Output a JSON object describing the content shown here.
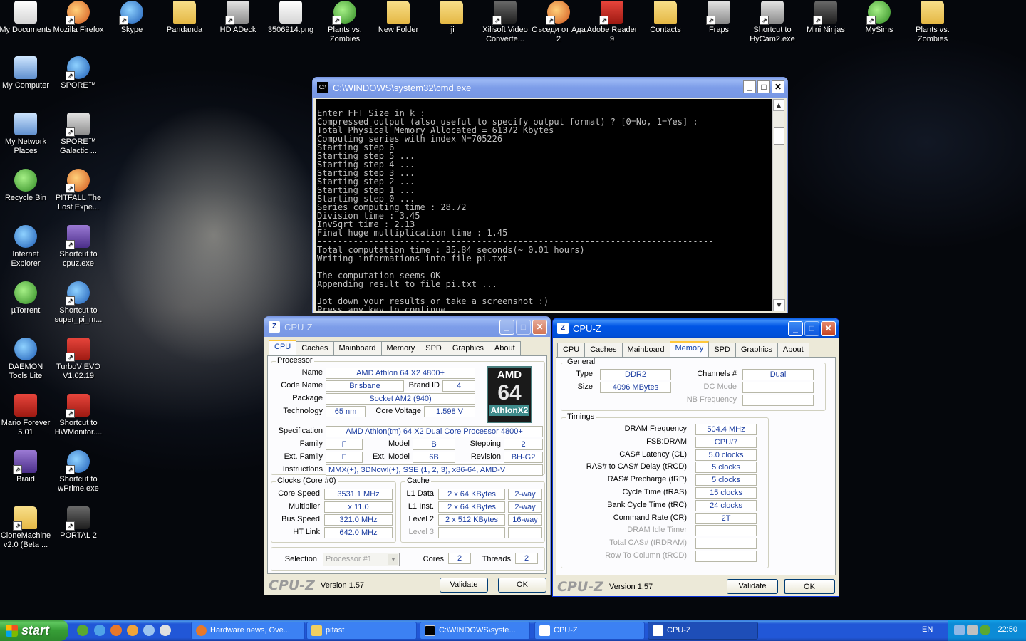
{
  "desktop": {
    "icons": [
      {
        "label": "My Documents",
        "icon": "documents-folder-icon"
      },
      {
        "label": "Mozilla Firefox",
        "icon": "firefox-icon"
      },
      {
        "label": "Skype",
        "icon": "skype-icon"
      },
      {
        "label": "Pandanda",
        "icon": "folder-icon"
      },
      {
        "label": "HD ADeck",
        "icon": "hd-adeck-icon"
      },
      {
        "label": "3506914.png",
        "icon": "png-file-icon"
      },
      {
        "label": "Plants vs. Zombies",
        "icon": "plants-vs-zombies-icon"
      },
      {
        "label": "New Folder",
        "icon": "folder-icon"
      },
      {
        "label": "iji",
        "icon": "folder-icon"
      },
      {
        "label": "Xilisoft Video Converte...",
        "icon": "xilisoft-icon"
      },
      {
        "label": "Съседи от Ада 2",
        "icon": "game-icon"
      },
      {
        "label": "Adobe Reader 9",
        "icon": "adobe-reader-icon"
      },
      {
        "label": "Contacts",
        "icon": "folder-icon"
      },
      {
        "label": "Fraps",
        "icon": "fraps-icon"
      },
      {
        "label": "Shortcut to HyCam2.exe",
        "icon": "hycam-icon"
      },
      {
        "label": "Mini Ninjas",
        "icon": "mini-ninjas-icon"
      },
      {
        "label": "MySims",
        "icon": "mysims-icon"
      },
      {
        "label": "Plants vs. Zombies",
        "icon": "folder-icon"
      },
      {
        "label": "My Computer",
        "icon": "my-computer-icon"
      },
      {
        "label": "SPORE™",
        "icon": "spore-icon"
      },
      {
        "label": "My Network Places",
        "icon": "network-places-icon"
      },
      {
        "label": "SPORE™ Galactic ...",
        "icon": "spore-galactic-icon"
      },
      {
        "label": "Recycle Bin",
        "icon": "recycle-bin-icon"
      },
      {
        "label": "PITFALL The Lost Expe...",
        "icon": "pitfall-icon"
      },
      {
        "label": "Internet Explorer",
        "icon": "internet-explorer-icon"
      },
      {
        "label": "Shortcut to cpuz.exe",
        "icon": "cpuz-icon"
      },
      {
        "label": "µTorrent",
        "icon": "utorrent-icon"
      },
      {
        "label": "Shortcut to super_pi_m...",
        "icon": "super-pi-icon"
      },
      {
        "label": "DAEMON Tools Lite",
        "icon": "daemon-tools-icon"
      },
      {
        "label": "TurboV EVO V1.02.19",
        "icon": "turbov-icon"
      },
      {
        "label": "Mario Forever 5.01",
        "icon": "mario-icon"
      },
      {
        "label": "Shortcut to HWMonitor....",
        "icon": "hwmonitor-icon"
      },
      {
        "label": "Braid",
        "icon": "braid-icon"
      },
      {
        "label": "Shortcut to wPrime.exe",
        "icon": "wprime-icon"
      },
      {
        "label": "CloneMachine v2.0 (Beta ...",
        "icon": "folder-icon"
      },
      {
        "label": "PORTAL 2",
        "icon": "portal2-icon"
      }
    ]
  },
  "cmd": {
    "title": "C:\\WINDOWS\\system32\\cmd.exe",
    "lines": [
      "Enter FFT Size in k :",
      "Compressed output (also useful to specify output format) ? [0=No, 1=Yes] :",
      "Total Physical Memory Allocated = 61372 Kbytes",
      "Computing series with index N=705226",
      "Starting step 6",
      "Starting step 5 ...",
      "Starting step 4 ...",
      "Starting step 3 ...",
      "Starting step 2 ...",
      "Starting step 1 ...",
      "Starting step 0 ...",
      "Series computing time : 28.72",
      "Division time : 3.45",
      "InvSqrt time : 2.13",
      "Final huge multiplication time : 1.45",
      "-----------------------------------------------------------------------------",
      "Total computation time : 35.84 seconds(~ 0.01 hours)",
      "Writing informations into file pi.txt",
      "",
      "The computation seems OK",
      "Appending result to file pi.txt ...",
      "",
      "Jot down your results or take a screenshot :)",
      "Press any key to continue . . ."
    ]
  },
  "cpuz1": {
    "title": "CPU-Z",
    "tabs": [
      "CPU",
      "Caches",
      "Mainboard",
      "Memory",
      "SPD",
      "Graphics",
      "About"
    ],
    "processor": {
      "group": "Processor",
      "name_label": "Name",
      "name": "AMD Athlon 64 X2 4800+",
      "codename_label": "Code Name",
      "codename": "Brisbane",
      "brandid_label": "Brand ID",
      "brandid": "4",
      "package_label": "Package",
      "package": "Socket AM2 (940)",
      "tech_label": "Technology",
      "tech": "65 nm",
      "voltage_label": "Core Voltage",
      "voltage": "1.598 V",
      "spec_label": "Specification",
      "spec": "AMD Athlon(tm) 64 X2 Dual Core Processor 4800+",
      "family_label": "Family",
      "family": "F",
      "model_label": "Model",
      "model": "B",
      "stepping_label": "Stepping",
      "stepping": "2",
      "extfamily_label": "Ext. Family",
      "extfamily": "F",
      "extmodel_label": "Ext. Model",
      "extmodel": "6B",
      "revision_label": "Revision",
      "revision": "BH-G2",
      "instr_label": "Instructions",
      "instr": "MMX(+), 3DNow!(+), SSE (1, 2, 3), x86-64, AMD-V",
      "logo_brand": "AMD",
      "logo_num": "64",
      "logo_line": "AthlonX2"
    },
    "clocks": {
      "group": "Clocks (Core #0)",
      "corespeed_label": "Core Speed",
      "corespeed": "3531.1 MHz",
      "mult_label": "Multiplier",
      "mult": "x 11.0",
      "bus_label": "Bus Speed",
      "bus": "321.0 MHz",
      "ht_label": "HT Link",
      "ht": "642.0 MHz"
    },
    "cache": {
      "group": "Cache",
      "l1d_label": "L1 Data",
      "l1d": "2 x 64 KBytes",
      "l1d_way": "2-way",
      "l1i_label": "L1 Inst.",
      "l1i": "2 x 64 KBytes",
      "l1i_way": "2-way",
      "l2_label": "Level 2",
      "l2": "2 x 512 KBytes",
      "l2_way": "16-way",
      "l3_label": "Level 3"
    },
    "selection_label": "Selection",
    "selection": "Processor #1",
    "cores_label": "Cores",
    "cores": "2",
    "threads_label": "Threads",
    "threads": "2",
    "logo": "CPU-Z",
    "version": "Version 1.57",
    "validate": "Validate",
    "ok": "OK"
  },
  "cpuz2": {
    "title": "CPU-Z",
    "tabs": [
      "CPU",
      "Caches",
      "Mainboard",
      "Memory",
      "SPD",
      "Graphics",
      "About"
    ],
    "general": {
      "group": "General",
      "type_label": "Type",
      "type": "DDR2",
      "size_label": "Size",
      "size": "4096 MBytes",
      "channels_label": "Channels #",
      "channels": "Dual",
      "dcmode_label": "DC Mode",
      "nbfreq_label": "NB Frequency"
    },
    "timings": {
      "group": "Timings",
      "rows": [
        {
          "label": "DRAM Frequency",
          "value": "504.4 MHz",
          "dim": false
        },
        {
          "label": "FSB:DRAM",
          "value": "CPU/7",
          "dim": false
        },
        {
          "label": "CAS# Latency (CL)",
          "value": "5.0 clocks",
          "dim": false
        },
        {
          "label": "RAS# to CAS# Delay (tRCD)",
          "value": "5 clocks",
          "dim": false
        },
        {
          "label": "RAS# Precharge (tRP)",
          "value": "5 clocks",
          "dim": false
        },
        {
          "label": "Cycle Time (tRAS)",
          "value": "15 clocks",
          "dim": false
        },
        {
          "label": "Bank Cycle Time (tRC)",
          "value": "24 clocks",
          "dim": false
        },
        {
          "label": "Command Rate (CR)",
          "value": "2T",
          "dim": false
        },
        {
          "label": "DRAM Idle Timer",
          "value": "",
          "dim": true
        },
        {
          "label": "Total CAS# (tRDRAM)",
          "value": "",
          "dim": true
        },
        {
          "label": "Row To Column (tRCD)",
          "value": "",
          "dim": true
        }
      ]
    },
    "logo": "CPU-Z",
    "version": "Version 1.57",
    "validate": "Validate",
    "ok": "OK"
  },
  "taskbar": {
    "start": "start",
    "tasks": [
      {
        "label": "Hardware news, Ove..."
      },
      {
        "label": "pifast"
      },
      {
        "label": "C:\\WINDOWS\\syste..."
      },
      {
        "label": "CPU-Z"
      },
      {
        "label": "CPU-Z"
      }
    ],
    "lang": "EN",
    "clock": "22:50"
  }
}
